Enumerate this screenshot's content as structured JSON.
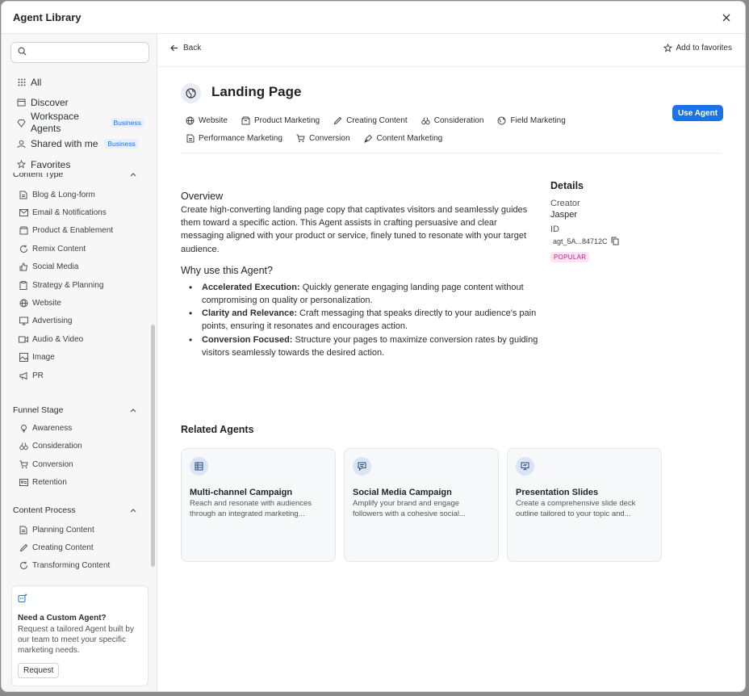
{
  "modal": {
    "title": "Agent Library"
  },
  "sidebar": {
    "search": {
      "placeholder": ""
    },
    "nav": [
      {
        "label": "All",
        "icon": "grid-icon"
      },
      {
        "label": "Discover",
        "icon": "calendar-icon"
      },
      {
        "label": "Workspace Agents",
        "icon": "diamond-icon",
        "badge": "Business"
      },
      {
        "label": "Shared with me",
        "icon": "user-icon",
        "badge": "Business"
      },
      {
        "label": "Favorites",
        "icon": "star-icon"
      }
    ],
    "content_type": {
      "title": "Content Type",
      "items": [
        "Blog & Long-form",
        "Email & Notifications",
        "Product & Enablement",
        "Remix Content",
        "Social Media",
        "Strategy & Planning",
        "Website",
        "Advertising",
        "Audio & Video",
        "Image",
        "PR"
      ]
    },
    "funnel_stage": {
      "title": "Funnel Stage",
      "items": [
        "Awareness",
        "Consideration",
        "Conversion",
        "Retention"
      ]
    },
    "content_process": {
      "title": "Content Process",
      "items": [
        "Planning Content",
        "Creating Content",
        "Transforming Content"
      ]
    },
    "custom": {
      "title": "Need a Custom Agent?",
      "desc": "Request a tailored Agent built by our team to meet your specific marketing needs.",
      "button": "Request"
    }
  },
  "main": {
    "back_label": "Back",
    "fav_label": "Add to favorites",
    "title": "Landing Page",
    "use_label": "Use Agent",
    "tags_row1": [
      "Website",
      "Product Marketing",
      "Creating Content",
      "Consideration",
      "Field Marketing"
    ],
    "tags_row2": [
      "Performance Marketing",
      "Conversion",
      "Content Marketing"
    ],
    "overview_title": "Overview",
    "overview_text": "Create high-converting landing page copy that captivates visitors and seamlessly guides them toward a specific action. This Agent assists in crafting persuasive and clear messaging aligned with your product or service, finely tuned to resonate with your target audience.",
    "why_title": "Why use this Agent?",
    "why": [
      {
        "bold": "Accelerated Execution:",
        "text": " Quickly generate engaging landing page content without compromising on quality or personalization."
      },
      {
        "bold": "Clarity and Relevance:",
        "text": " Craft messaging that speaks directly to your audience's pain points, ensuring it resonates and encourages action."
      },
      {
        "bold": "Conversion Focused:",
        "text": " Structure your pages to maximize conversion rates by guiding visitors seamlessly towards the desired action."
      }
    ],
    "details": {
      "title": "Details",
      "creator_label": "Creator",
      "creator": "Jasper",
      "id_label": "ID",
      "id": "agt_5A...84712C",
      "badge": "POPULAR"
    },
    "related_title": "Related Agents",
    "related": [
      {
        "title": "Multi-channel Campaign",
        "desc": "Reach and resonate with audiences through an integrated marketing...",
        "icon": "table-icon"
      },
      {
        "title": "Social Media Campaign",
        "desc": "Amplify your brand and engage followers with a cohesive social...",
        "icon": "chat-icon"
      },
      {
        "title": "Presentation Slides",
        "desc": "Create a comprehensive slide deck outline tailored to your topic and...",
        "icon": "presentation-icon"
      }
    ]
  }
}
